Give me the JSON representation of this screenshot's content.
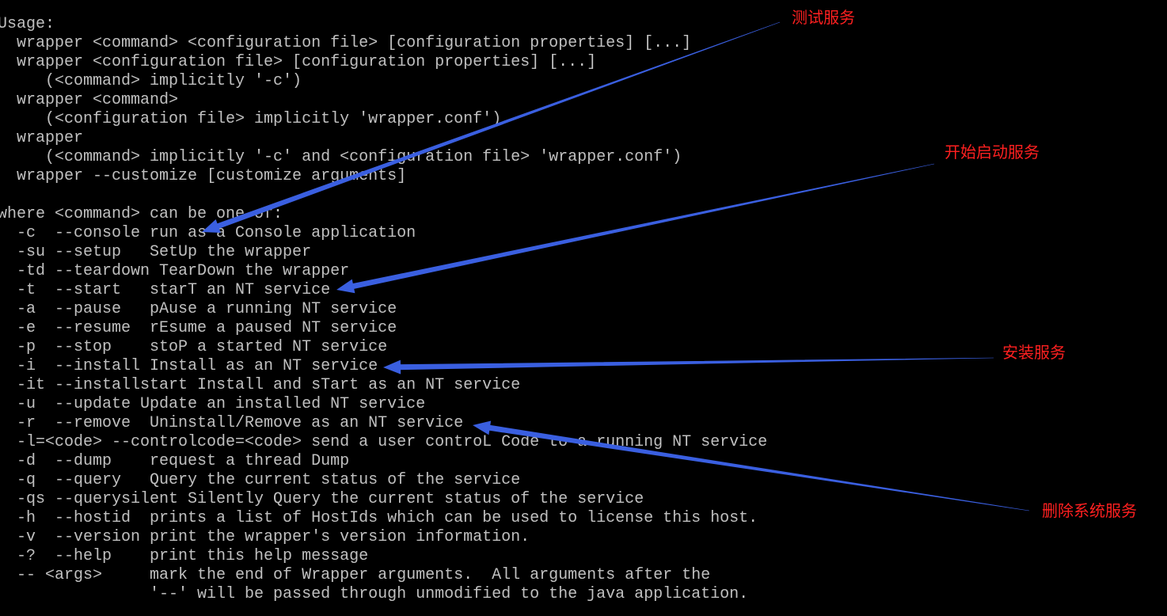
{
  "console": {
    "text_color": "#c0c0c0",
    "background": "#000000",
    "lines": [
      "Usage:",
      "  wrapper <command> <configuration file> [configuration properties] [...]",
      "  wrapper <configuration file> [configuration properties] [...]",
      "     (<command> implicitly '-c')",
      "  wrapper <command>",
      "     (<configuration file> implicitly 'wrapper.conf')",
      "  wrapper",
      "     (<command> implicitly '-c' and <configuration file> 'wrapper.conf')",
      "  wrapper --customize [customize arguments]",
      "",
      "where <command> can be one of:",
      "  -c  --console run as a Console application",
      "  -su --setup   SetUp the wrapper",
      "  -td --teardown TearDown the wrapper",
      "  -t  --start   starT an NT service",
      "  -a  --pause   pAuse a running NT service",
      "  -e  --resume  rEsume a paused NT service",
      "  -p  --stop    stoP a started NT service",
      "  -i  --install Install as an NT service",
      "  -it --installstart Install and sTart as an NT service",
      "  -u  --update Update an installed NT service",
      "  -r  --remove  Uninstall/Remove as an NT service",
      "  -l=<code> --controlcode=<code> send a user controL Code to a running NT service",
      "  -d  --dump    request a thread Dump",
      "  -q  --query   Query the current status of the service",
      "  -qs --querysilent Silently Query the current status of the service",
      "  -h  --hostid  prints a list of HostIds which can be used to license this host.",
      "  -v  --version print the wrapper's version information.",
      "  -?  --help    print this help message",
      "  -- <args>     mark the end of Wrapper arguments.  All arguments after the",
      "                '--' will be passed through unmodified to the java application."
    ]
  },
  "annotations": {
    "label_color": "#ff2020",
    "arrow_color": "#3a5fe0",
    "items": [
      {
        "label": "测试服务"
      },
      {
        "label": "开始启动服务"
      },
      {
        "label": "安装服务"
      },
      {
        "label": "删除系统服务"
      }
    ]
  }
}
